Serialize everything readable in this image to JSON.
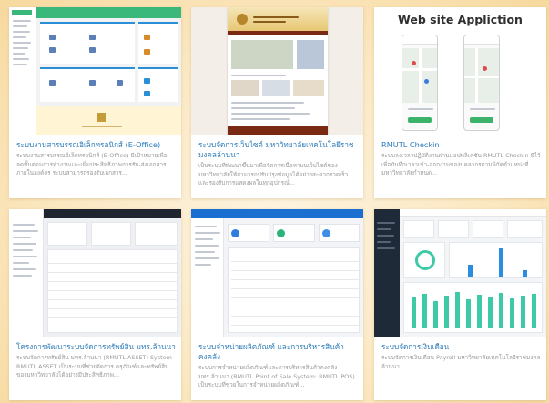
{
  "cards": [
    {
      "title": "ระบบงานสารบรรณอิเล็กทรอนิกส์ (E-Office)",
      "desc": "ระบบงานสารบรรณอิเล็กทรอนิกส์ (E-Office) มีเป้าหมายเพื่อ ลดขั้นตอนการทำงานและเพิ่มประสิทธิภาพการรับ-ส่งเอกสารภายในองค์กร ระบบสามารถรองรับเอกสาร...",
      "screenshot": "e-office-dashboard"
    },
    {
      "title": "ระบบจัดการเว็บไซต์ มหาวิทยาลัยเทคโนโลยีราชมงคลล้านนา",
      "desc": "เป็นระบบที่พัฒนาขึ้นมาเพื่อจัดการเนื้อหาบนเว็บไซต์ของมหาวิทยาลัยให้สามารถปรับปรุงข้อมูลได้อย่างสะดวกรวดเร็ว และรองรับการแสดงผลในทุกอุปกรณ์...",
      "screenshot": "university-website"
    },
    {
      "title": "RMUTL Checkin",
      "desc": "ระบบลงเวลาปฏิบัติงานผ่านแอปพลิเคชัน RMUTL Checkin มีไว้เพื่อบันทึกเวลาเข้า-ออกงานของบุคลากรตามพิกัดตำแหน่งที่มหาวิทยาลัยกำหนด...",
      "screenshot_heading": "Web site Appliction"
    },
    {
      "title": "โครงการพัฒนาระบบจัดการทรัพย์สิน มทร.ล้านนา",
      "desc": "ระบบจัดการทรัพย์สิน มทร.ล้านนา (RMUTL ASSET) System RMUTL ASSET เป็นระบบที่ช่วยจัดการ ครุภัณฑ์และทรัพย์สินของมหาวิทยาลัยได้อย่างมีประสิทธิภาพ...",
      "screenshot": "asset-dashboard"
    },
    {
      "title": "ระบบจำหน่ายผลิตภัณฑ์ และการบริหารสินค้าคงคลัง",
      "desc": "ระบบการจำหน่ายผลิตภัณฑ์และการบริหารสินค้าคงคลัง มทร.ล้านนา (RMUTL Point of Sale System: RMUTL POS) เป็นระบบที่ช่วยในการจำหน่ายผลิตภัณฑ์...",
      "screenshot": "pos-dashboard"
    },
    {
      "title": "ระบบจัดการเงินเดือน",
      "desc": "ระบบจัดการเงินเดือน Payroll มหาวิทยาลัยเทคโนโลยีราชมงคลล้านนา",
      "screenshot": "payroll-dashboard"
    }
  ],
  "colors": {
    "title": "#2a7ab8",
    "desc": "#9a9a9a",
    "background": "#fbe9c4"
  }
}
